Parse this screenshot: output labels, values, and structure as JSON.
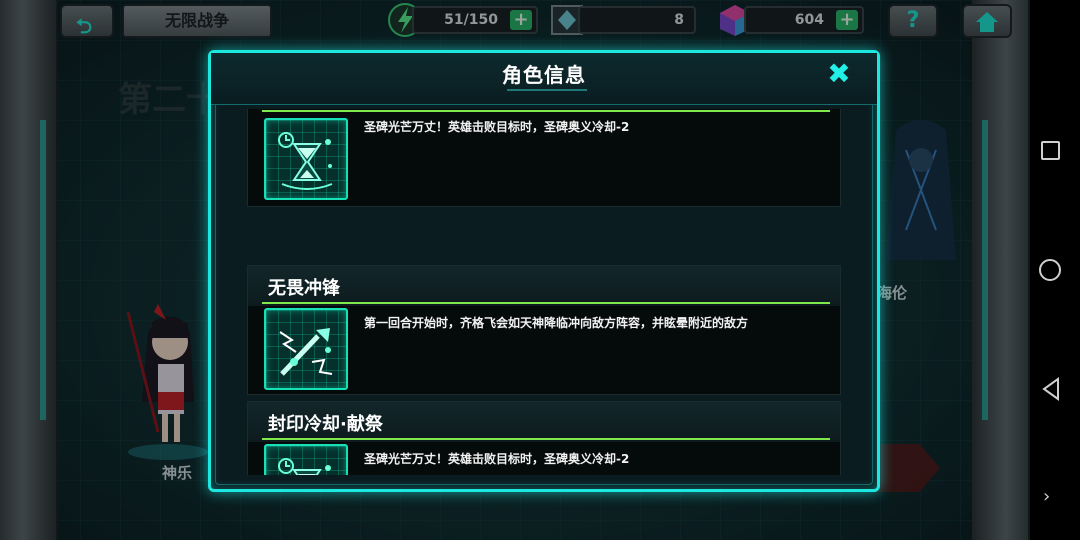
{
  "topbar": {
    "mode_title": "无限战争",
    "energy_value": "51/150",
    "crystal_value": "8",
    "gem_value": "604",
    "help_glyph": "?",
    "plus_glyph": "+"
  },
  "background": {
    "chapter_text": "第二十",
    "left_character_name": "神乐",
    "right_character_name": "争海伦"
  },
  "dialog": {
    "title": "角色信息",
    "close_glyph": "✖",
    "skills": [
      {
        "name": "",
        "description": "圣碑光芒万丈！英雄击败目标时，圣碑奥义冷却-2",
        "icon": "hourglass-icon"
      },
      {
        "name": "无畏冲锋",
        "description": "第一回合开始时，齐格飞会如天神降临冲向敌方阵容，并眩晕附近的敌方",
        "icon": "charge-strike-icon"
      },
      {
        "name": "封印冷却·献祭",
        "description": "圣碑光芒万丈！英雄击败目标时，圣碑奥义冷却-2",
        "icon": "hourglass-icon"
      }
    ]
  },
  "colors": {
    "accent_cyan": "#1de8e0",
    "skill_divider_green": "#7de94a",
    "icon_teal": "#17e0b6",
    "plus_green": "#2ab56c"
  },
  "navbar": {
    "icons": [
      "square-recents-icon",
      "circle-home-icon",
      "triangle-back-icon",
      "chevron-right-icon"
    ]
  }
}
